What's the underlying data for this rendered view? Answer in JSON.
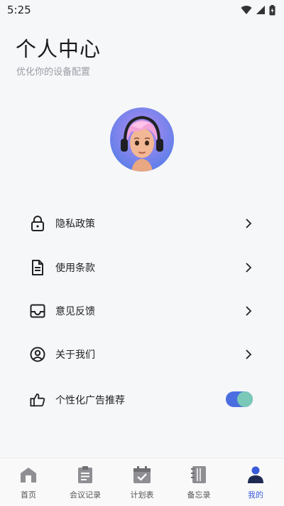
{
  "status_bar": {
    "time": "5:25"
  },
  "header": {
    "title": "个人中心",
    "subtitle": "优化你的设备配置"
  },
  "menu": {
    "items": [
      {
        "label": "隐私政策",
        "icon": "lock-icon"
      },
      {
        "label": "使用条款",
        "icon": "document-icon"
      },
      {
        "label": "意见反馈",
        "icon": "inbox-icon"
      },
      {
        "label": "关于我们",
        "icon": "user-circle-icon"
      }
    ],
    "ad_toggle": {
      "label": "个性化广告推荐",
      "icon": "thumbs-up-icon",
      "enabled": true
    }
  },
  "colors": {
    "accent": "#3a5bd9",
    "toggle_track": "#4a6ee0",
    "toggle_knob": "#79c8b8"
  },
  "tabs": [
    {
      "label": "首页",
      "icon": "home-icon",
      "active": false
    },
    {
      "label": "会议记录",
      "icon": "clipboard-icon",
      "active": false
    },
    {
      "label": "计划表",
      "icon": "calendar-check-icon",
      "active": false
    },
    {
      "label": "备忘录",
      "icon": "notebook-icon",
      "active": false
    },
    {
      "label": "我的",
      "icon": "profile-icon",
      "active": true
    }
  ]
}
